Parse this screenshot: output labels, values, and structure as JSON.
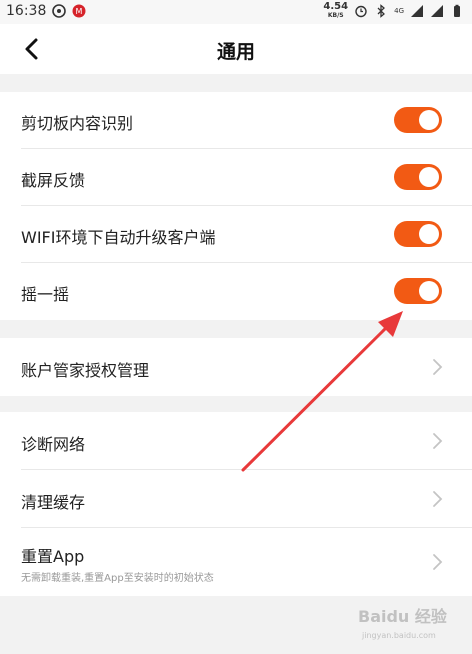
{
  "status_bar": {
    "time": "16:38",
    "net_speed_value": "4.54",
    "net_speed_unit": "KB/S",
    "signal_label": "4G"
  },
  "header": {
    "title": "通用"
  },
  "settings_toggles": [
    {
      "label": "剪切板内容识别",
      "on": true
    },
    {
      "label": "截屏反馈",
      "on": true
    },
    {
      "label": "WIFI环境下自动升级客户端",
      "on": true
    },
    {
      "label": "摇一摇",
      "on": true
    }
  ],
  "account_section": {
    "label": "账户管家授权管理"
  },
  "misc_section": {
    "items": [
      {
        "label": "诊断网络"
      },
      {
        "label": "清理缓存"
      },
      {
        "label": "重置App",
        "sublabel": "无需卸载重装,重置App至安装时的初始状态"
      }
    ]
  },
  "colors": {
    "accent": "#f25a14",
    "arrow": "#e8393a",
    "background": "#f2f2f2"
  },
  "watermark": {
    "text": "Baidu 经验",
    "subtext": "jingyan.baidu.com"
  }
}
